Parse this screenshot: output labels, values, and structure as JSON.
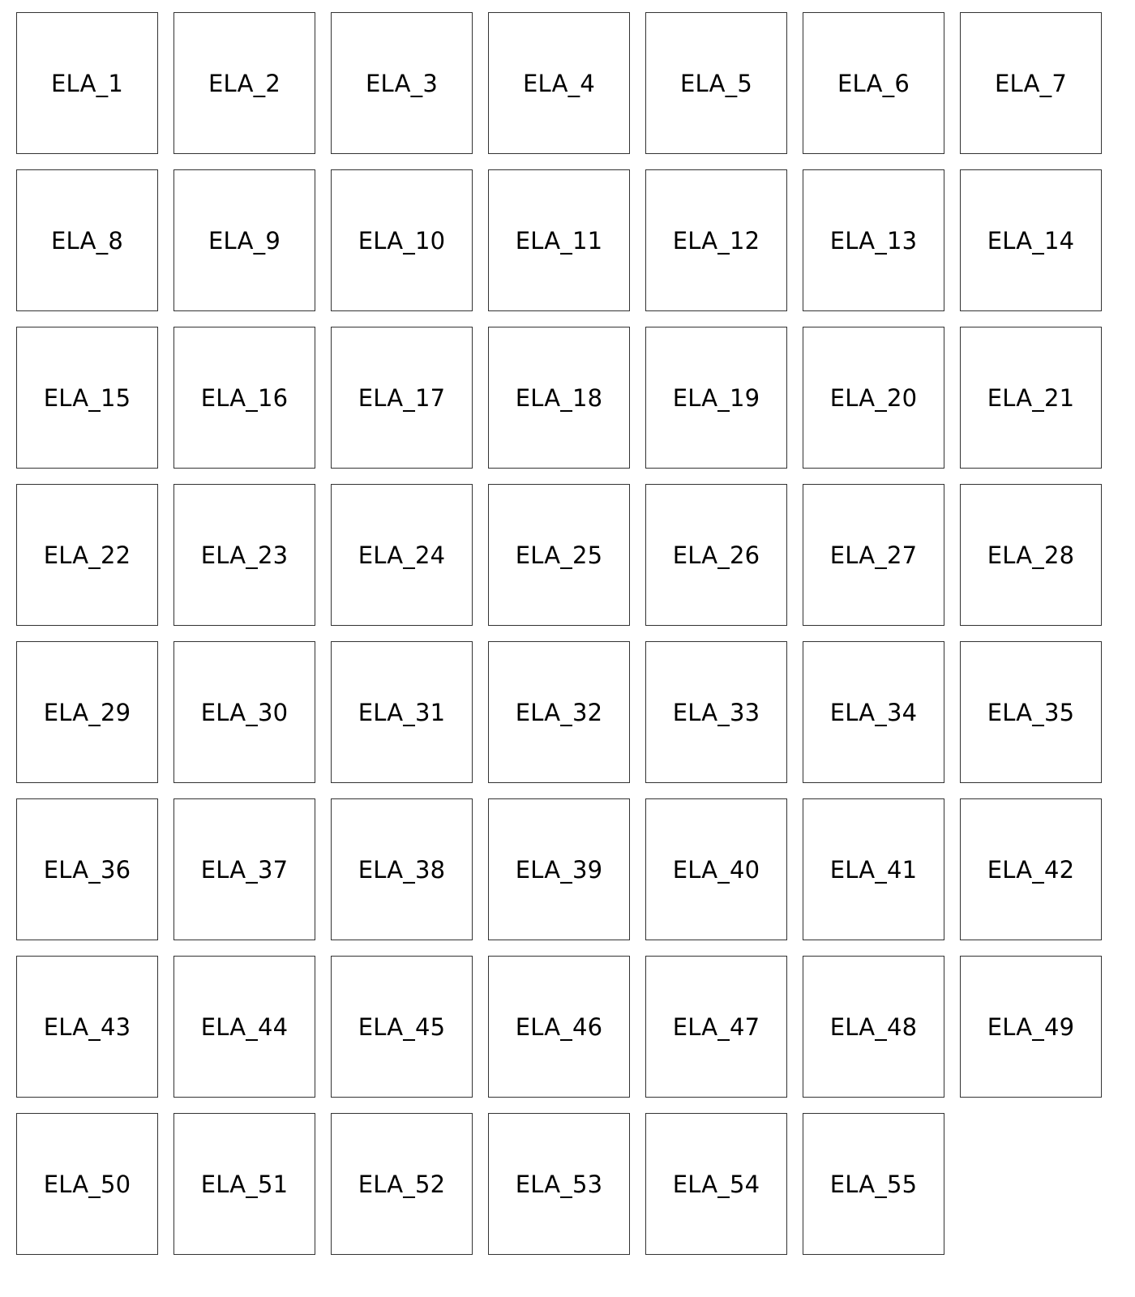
{
  "tiles": [
    {
      "label": "ELA_1"
    },
    {
      "label": "ELA_2"
    },
    {
      "label": "ELA_3"
    },
    {
      "label": "ELA_4"
    },
    {
      "label": "ELA_5"
    },
    {
      "label": "ELA_6"
    },
    {
      "label": "ELA_7"
    },
    {
      "label": "ELA_8"
    },
    {
      "label": "ELA_9"
    },
    {
      "label": "ELA_10"
    },
    {
      "label": "ELA_11"
    },
    {
      "label": "ELA_12"
    },
    {
      "label": "ELA_13"
    },
    {
      "label": "ELA_14"
    },
    {
      "label": "ELA_15"
    },
    {
      "label": "ELA_16"
    },
    {
      "label": "ELA_17"
    },
    {
      "label": "ELA_18"
    },
    {
      "label": "ELA_19"
    },
    {
      "label": "ELA_20"
    },
    {
      "label": "ELA_21"
    },
    {
      "label": "ELA_22"
    },
    {
      "label": "ELA_23"
    },
    {
      "label": "ELA_24"
    },
    {
      "label": "ELA_25"
    },
    {
      "label": "ELA_26"
    },
    {
      "label": "ELA_27"
    },
    {
      "label": "ELA_28"
    },
    {
      "label": "ELA_29"
    },
    {
      "label": "ELA_30"
    },
    {
      "label": "ELA_31"
    },
    {
      "label": "ELA_32"
    },
    {
      "label": "ELA_33"
    },
    {
      "label": "ELA_34"
    },
    {
      "label": "ELA_35"
    },
    {
      "label": "ELA_36"
    },
    {
      "label": "ELA_37"
    },
    {
      "label": "ELA_38"
    },
    {
      "label": "ELA_39"
    },
    {
      "label": "ELA_40"
    },
    {
      "label": "ELA_41"
    },
    {
      "label": "ELA_42"
    },
    {
      "label": "ELA_43"
    },
    {
      "label": "ELA_44"
    },
    {
      "label": "ELA_45"
    },
    {
      "label": "ELA_46"
    },
    {
      "label": "ELA_47"
    },
    {
      "label": "ELA_48"
    },
    {
      "label": "ELA_49"
    },
    {
      "label": "ELA_50"
    },
    {
      "label": "ELA_51"
    },
    {
      "label": "ELA_52"
    },
    {
      "label": "ELA_53"
    },
    {
      "label": "ELA_54"
    },
    {
      "label": "ELA_55"
    }
  ]
}
